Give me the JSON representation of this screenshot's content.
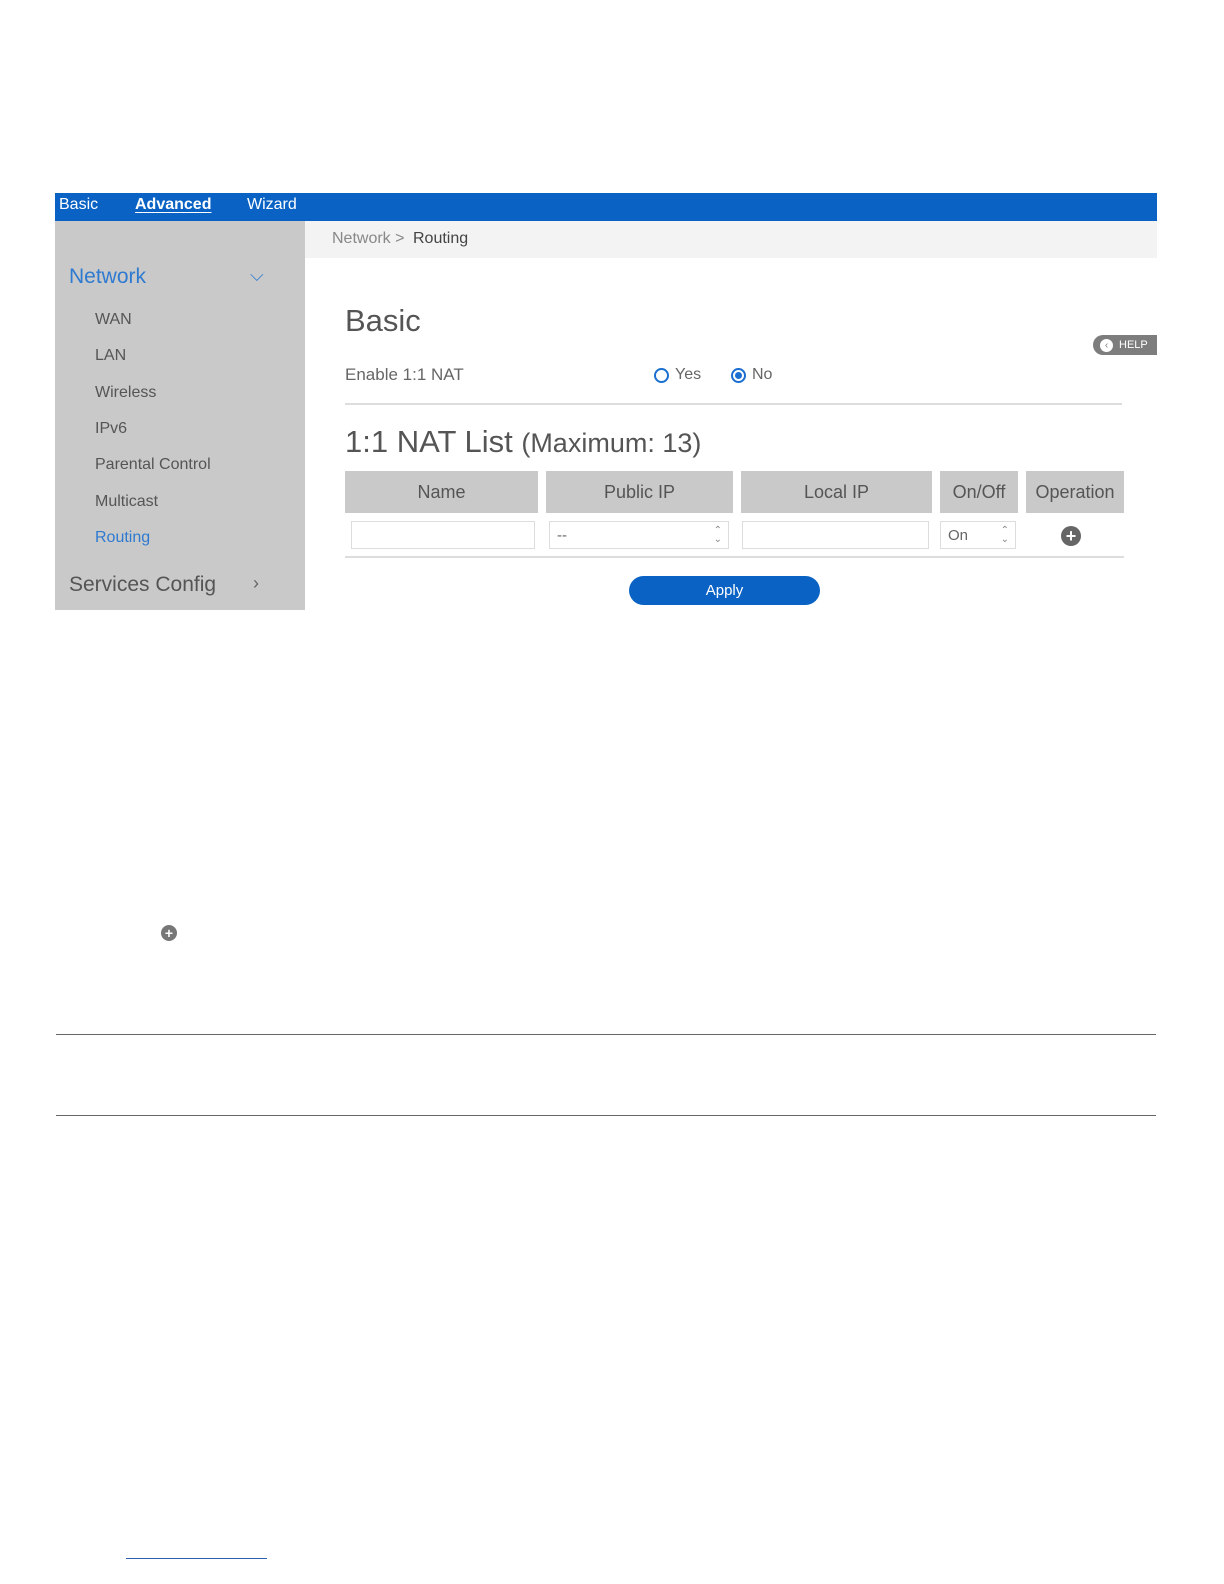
{
  "topnav": {
    "basic": "Basic",
    "advanced": "Advanced",
    "wizard": "Wizard"
  },
  "sidebar": {
    "network_label": "Network",
    "items": [
      {
        "label": "WAN"
      },
      {
        "label": "LAN"
      },
      {
        "label": "Wireless"
      },
      {
        "label": "IPv6"
      },
      {
        "label": "Parental Control"
      },
      {
        "label": "Multicast"
      },
      {
        "label": "Routing",
        "active": true
      }
    ],
    "services_label": "Services Config"
  },
  "breadcrumb": {
    "parent": "Network >",
    "current": "Routing"
  },
  "basic": {
    "title": "Basic",
    "help_label": "HELP",
    "enable_label": "Enable 1:1 NAT",
    "yes_label": "Yes",
    "no_label": "No",
    "selected": "No"
  },
  "nat_list": {
    "title": "1:1 NAT List",
    "max_label": "(Maximum: 13)",
    "columns": [
      "Name",
      "Public IP",
      "Local IP",
      "On/Off",
      "Operation"
    ],
    "row": {
      "name_value": "",
      "public_ip_value": "--",
      "local_ip_value": "",
      "onoff_value": "On"
    }
  },
  "apply_label": "Apply",
  "colors": {
    "brand_blue": "#0a63c4",
    "accent_blue": "#2e7ad1",
    "sidebar_gray": "#c9c9c9"
  }
}
